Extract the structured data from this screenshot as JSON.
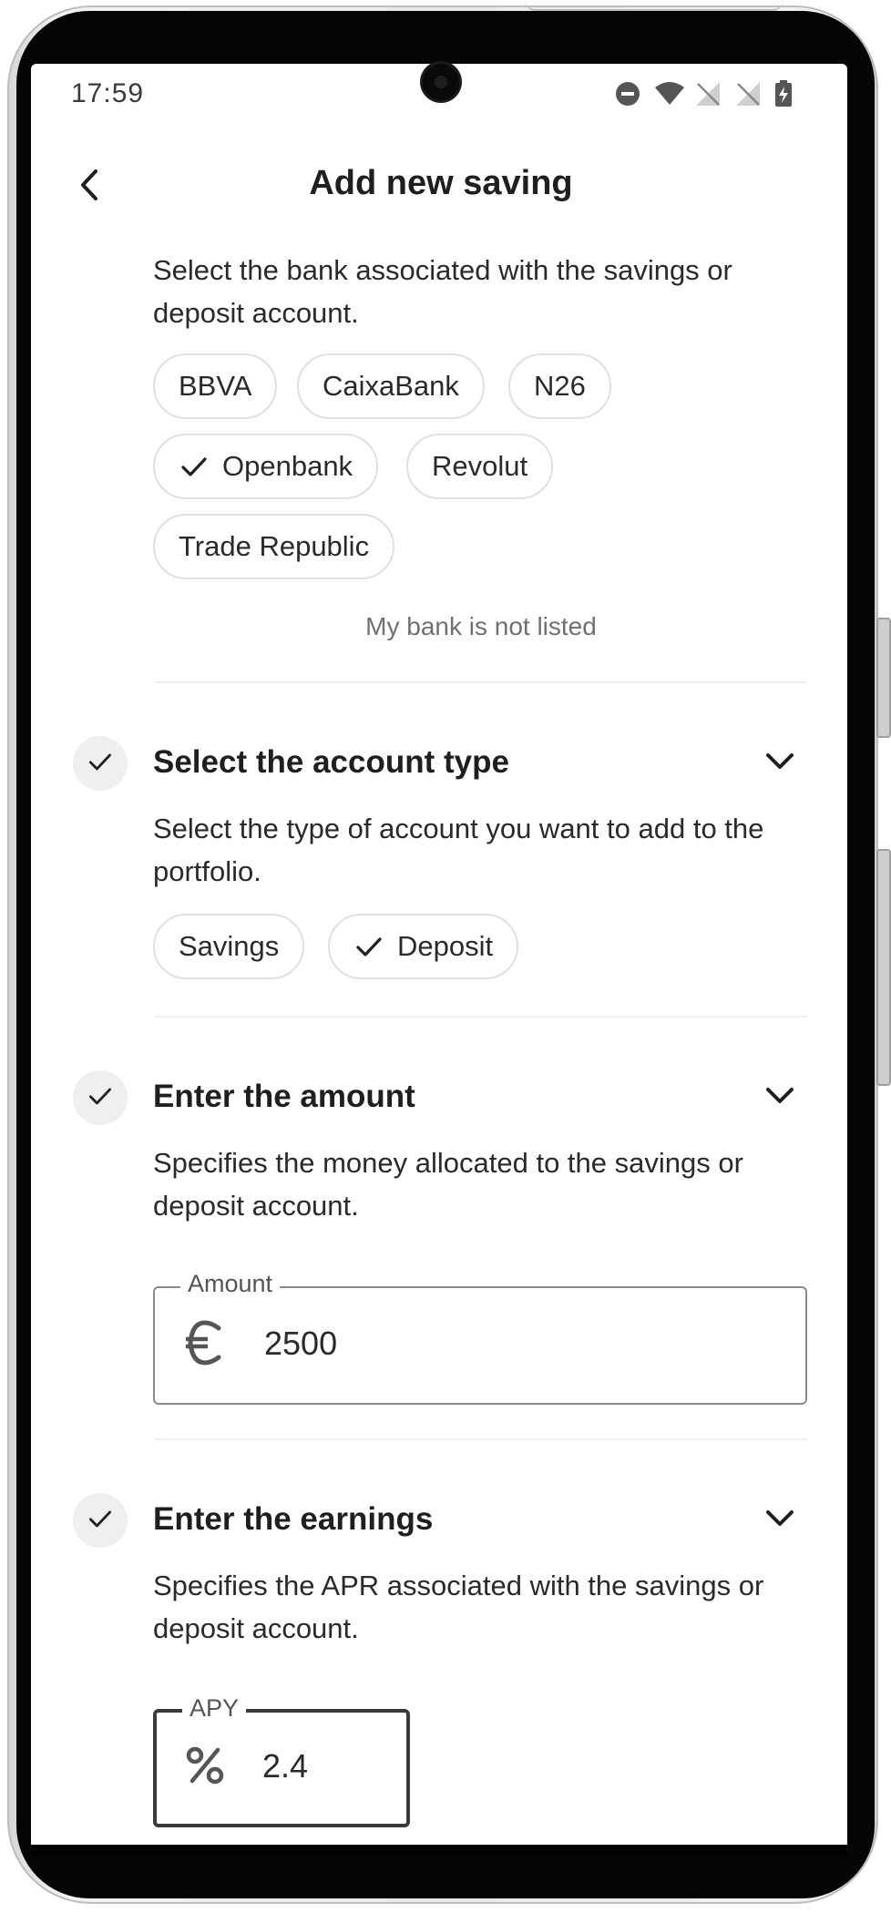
{
  "status_bar": {
    "time": "17:59"
  },
  "header": {
    "title": "Add new saving"
  },
  "bank_step": {
    "description": "Select the bank associated with the savings or deposit account.",
    "options": [
      {
        "label": "BBVA",
        "selected": false
      },
      {
        "label": "CaixaBank",
        "selected": false
      },
      {
        "label": "N26",
        "selected": false
      },
      {
        "label": "Openbank",
        "selected": true
      },
      {
        "label": "Revolut",
        "selected": false
      },
      {
        "label": "Trade Republic",
        "selected": false
      }
    ],
    "not_listed_link": "My bank is not listed"
  },
  "account_type_step": {
    "title": "Select the account type",
    "description": "Select the type of account you want to add to the portfolio.",
    "options": [
      {
        "label": "Savings",
        "selected": false
      },
      {
        "label": "Deposit",
        "selected": true
      }
    ]
  },
  "amount_step": {
    "title": "Enter the amount",
    "description": "Specifies the money allocated to the savings or deposit account.",
    "field_label": "Amount",
    "prefix_icon": "euro-icon",
    "value": "2500"
  },
  "earnings_step": {
    "title": "Enter the earnings",
    "description": "Specifies the APR associated with the savings or deposit account.",
    "field_label": "APY",
    "prefix_icon": "percent-icon",
    "value": "2.4"
  },
  "colors": {
    "text": "#1f1f1f",
    "chip_border": "#e0e0e0",
    "badge_bg": "#efefef",
    "link": "#707070"
  }
}
